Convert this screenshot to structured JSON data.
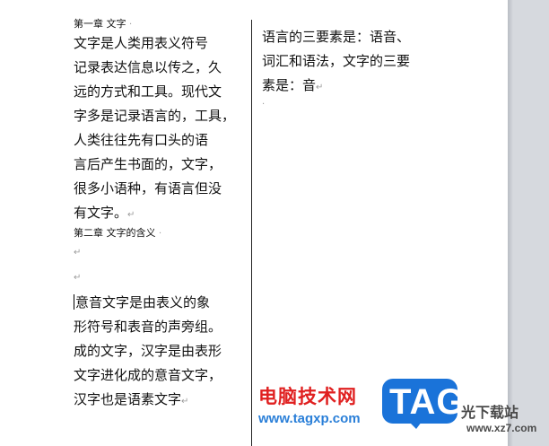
{
  "document": {
    "left_column": {
      "heading1": "第一章 文字",
      "para1_lines": [
        "文字是人类用表义符号",
        "记录表达信息以传之，久",
        "远的方式和工具。现代文",
        "字多是记录语言的，工具，",
        "人类往往先有口头的语",
        "言后产生书面的，文字，",
        "很多小语种，有语言但没",
        "有文字。"
      ],
      "heading2": "第二章 文字的含义",
      "para2_lines": [
        "意音文字是由表义的象",
        "形符号和表音的声旁组。",
        "成的文字，汉字是由表形",
        "文字进化成的意音文字，",
        "汉字也是语素文字"
      ]
    },
    "right_column": {
      "para_lines": [
        "语言的三要素是：语音、",
        "词汇和语法，文字的三要",
        "素是：音"
      ]
    },
    "marks": {
      "paragraph": "↵",
      "small": "·"
    }
  },
  "watermark": {
    "site_name": "电脑技术网",
    "site_url": "www.tagxp.com",
    "logo_text": "TAG",
    "partner_name": "光下载站",
    "partner_url": "www.xz7.com"
  },
  "colors": {
    "watermark_red": "#e02020",
    "watermark_blue": "#2a7fd8",
    "gutter": "#d6d9de"
  }
}
